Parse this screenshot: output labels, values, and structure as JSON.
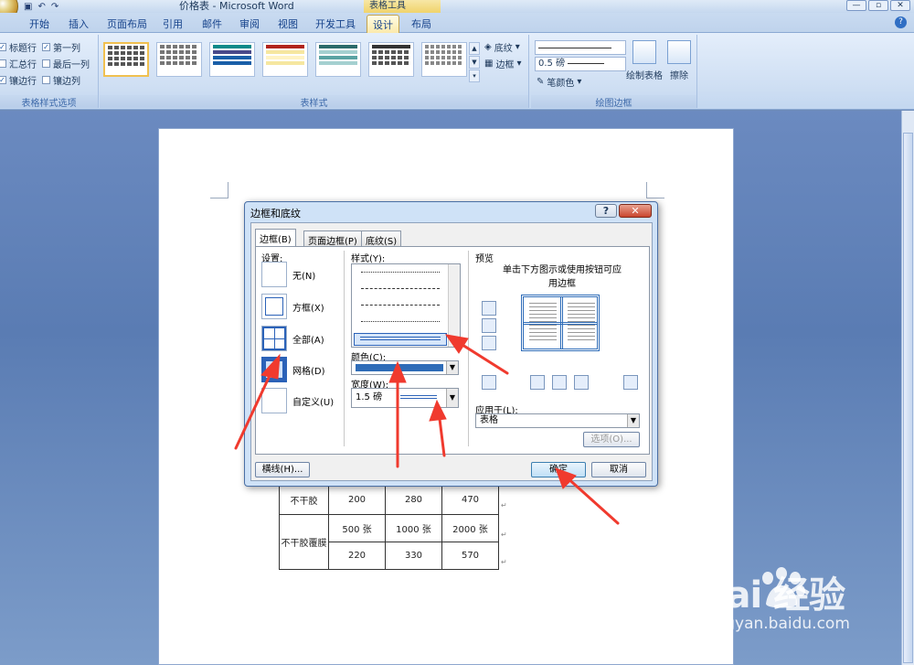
{
  "window": {
    "title": "价格表 - Microsoft Word",
    "context_tab": "表格工具",
    "controls": [
      "—",
      "▫",
      "✕"
    ],
    "help": "?"
  },
  "qat": {
    "save": "▣",
    "undo": "↶",
    "redo": "↷"
  },
  "ribbon_tabs": [
    "开始",
    "插入",
    "页面布局",
    "引用",
    "邮件",
    "审阅",
    "视图",
    "开发工具",
    "设计",
    "布局"
  ],
  "active_tab": "设计",
  "table_style_options": {
    "label": "表格样式选项",
    "items": [
      {
        "label": "标题行",
        "checked": true
      },
      {
        "label": "第一列",
        "checked": true
      },
      {
        "label": "汇总行",
        "checked": false
      },
      {
        "label": "最后一列",
        "checked": false
      },
      {
        "label": "镶边行",
        "checked": true
      },
      {
        "label": "镶边列",
        "checked": false
      }
    ]
  },
  "table_styles": {
    "label": "表样式",
    "shading": "底纹",
    "borders": "边框"
  },
  "draw_borders": {
    "label": "绘图边框",
    "line_weight": "0.5 磅",
    "pen_color": "笔颜色",
    "draw_table": "绘制表格",
    "eraser": "擦除"
  },
  "dialog": {
    "title": "边框和底纹",
    "help": "?",
    "close": "✕",
    "tabs": [
      "边框(B)",
      "页面边框(P)",
      "底纹(S)"
    ],
    "setting_label": "设置:",
    "settings": [
      {
        "label": "无(N)"
      },
      {
        "label": "方框(X)"
      },
      {
        "label": "全部(A)"
      },
      {
        "label": "网格(D)"
      },
      {
        "label": "自定义(U)"
      }
    ],
    "style_label": "样式(Y):",
    "color_label": "颜色(C):",
    "color_value": "#2e6cb8",
    "width_label": "宽度(W):",
    "width_value": "1.5 磅",
    "preview_label": "预览",
    "preview_hint": "单击下方图示或使用按钮可应用边框",
    "apply_label": "应用于(L):",
    "apply_value": "表格",
    "options_btn": "选项(O)...",
    "hline_btn": "横线(H)...",
    "ok_btn": "确定",
    "cancel_btn": "取消"
  },
  "doc_table": {
    "rows": [
      [
        "不干胶",
        "200",
        "280",
        "470"
      ],
      [
        "不干胶覆膜",
        "500 张",
        "1000 张",
        "2000 张"
      ],
      [
        "",
        "220",
        "330",
        "570"
      ]
    ]
  },
  "watermark": {
    "brand": "Bai  经验",
    "url": "jingyan.baidu.com"
  },
  "arrow_color": "#f03a2e"
}
